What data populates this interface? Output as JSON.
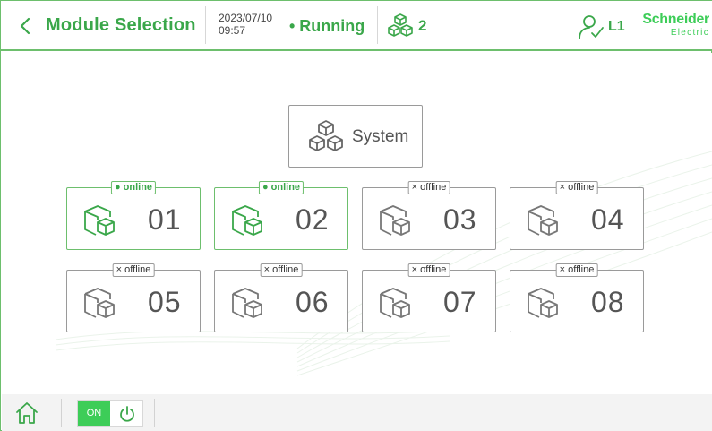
{
  "header": {
    "title": "Module Selection",
    "date": "2023/07/10",
    "time": "09:57",
    "status": "• Running",
    "module_count": "2",
    "user_level": "L1",
    "logo_line1": "Schneider",
    "logo_line2": "Electric"
  },
  "system_button": {
    "label": "System"
  },
  "modules": [
    {
      "number": "01",
      "status": "● online",
      "state": "online"
    },
    {
      "number": "02",
      "status": "● online",
      "state": "online"
    },
    {
      "number": "03",
      "status": "× offline",
      "state": "offline"
    },
    {
      "number": "04",
      "status": "× offline",
      "state": "offline"
    },
    {
      "number": "05",
      "status": "× offline",
      "state": "offline"
    },
    {
      "number": "06",
      "status": "× offline",
      "state": "offline"
    },
    {
      "number": "07",
      "status": "× offline",
      "state": "offline"
    },
    {
      "number": "08",
      "status": "× offline",
      "state": "offline"
    }
  ],
  "footer": {
    "power_label": "ON"
  },
  "icons": {
    "back": "chevron-left-icon",
    "modules": "cubes-icon",
    "user": "user-check-icon",
    "home": "home-icon",
    "power": "power-icon",
    "module": "module-cubes-icon"
  },
  "colors": {
    "accent": "#3aa74a",
    "brand": "#3dcd58",
    "border_online": "#6dbf6d",
    "border_offline": "#9a9a9a"
  }
}
